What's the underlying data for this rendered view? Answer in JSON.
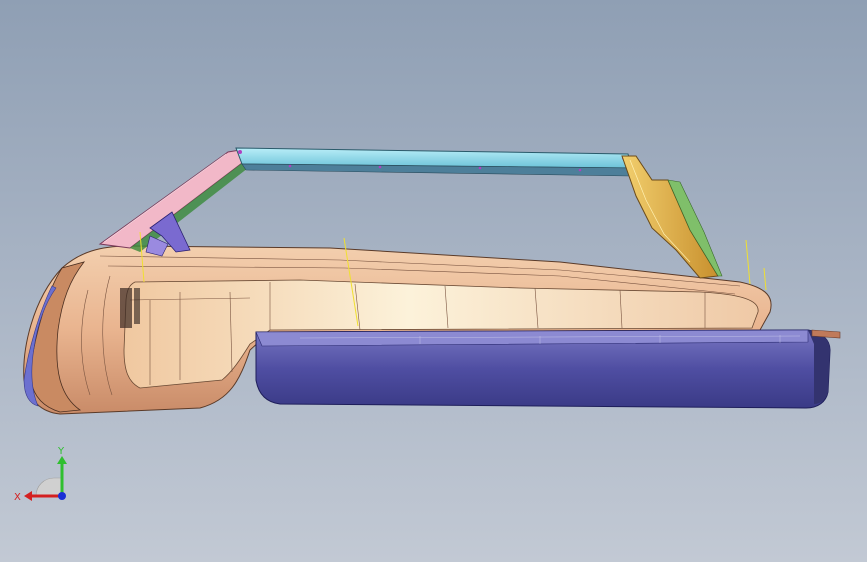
{
  "viewport": {
    "background_top": "#8f9fb4",
    "background_bottom": "#c2c9d4"
  },
  "triad": {
    "x_label": "X",
    "y_label": "Y",
    "x_color": "#d42020",
    "y_color": "#2fbf2f",
    "z_color": "#1a2fd6"
  },
  "model": {
    "parts": [
      "outer-shell",
      "inner-panel",
      "lower-side-rail",
      "windshield-frame",
      "roof-bar",
      "rear-pillar",
      "front-bracket"
    ],
    "colors": {
      "shell": "#e8b08a",
      "shell_highlight": "#f8e8c8",
      "rail": "#4b4a9c",
      "roof_bar": "#8fd6e6",
      "windshield": "#f0b8c8",
      "rear_pillar": "#e0b04a",
      "bracket": "#7a6ad0"
    }
  }
}
